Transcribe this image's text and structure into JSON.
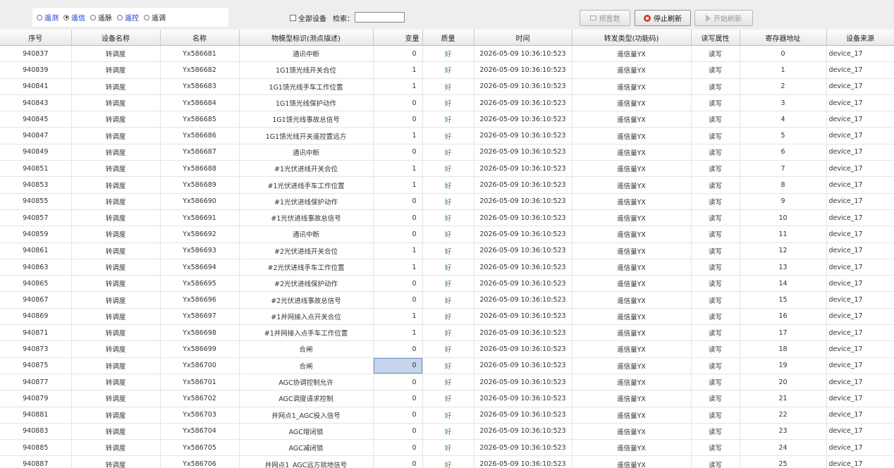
{
  "toolbar": {
    "radios": [
      {
        "label": "遥测",
        "selected": false,
        "color": "#1a36c4"
      },
      {
        "label": "遥信",
        "selected": true,
        "color": "#1a36c4"
      },
      {
        "label": "遥脉",
        "selected": false,
        "color": "#222222"
      },
      {
        "label": "遥控",
        "selected": false,
        "color": "#1a36c4"
      },
      {
        "label": "遥调",
        "selected": false,
        "color": "#222222"
      }
    ],
    "all_devices_label": "全部设备",
    "all_devices_checked": false,
    "search_label": "检索：",
    "search_value": "",
    "preset_button": "预置数",
    "stop_refresh_button": "停止刷新",
    "start_refresh_button": "开始刷新"
  },
  "table": {
    "columns": [
      "序号",
      "设备名称",
      "名称",
      "物模型标识(测点描述)",
      "变量",
      "质量",
      "时间",
      "转发类型(功能码)",
      "读写属性",
      "寄存器地址",
      "设备来源"
    ],
    "selected_row": 19,
    "selected_col": 4,
    "rows": [
      [
        "940837",
        "转调度",
        "Yx586681",
        "通讯中断",
        "0",
        "好",
        "2026-05-09 10:36:10:523",
        "遥信量YX",
        "读写",
        "0",
        "device_17"
      ],
      [
        "940839",
        "转调度",
        "Yx586682",
        "1G1馈光线开关合位",
        "1",
        "好",
        "2026-05-09 10:36:10:523",
        "遥信量YX",
        "读写",
        "1",
        "device_17"
      ],
      [
        "940841",
        "转调度",
        "Yx586683",
        "1G1馈光线手车工作位置",
        "1",
        "好",
        "2026-05-09 10:36:10:523",
        "遥信量YX",
        "读写",
        "2",
        "device_17"
      ],
      [
        "940843",
        "转调度",
        "Yx586684",
        "1G1馈光线保护动作",
        "0",
        "好",
        "2026-05-09 10:36:10:523",
        "遥信量YX",
        "读写",
        "3",
        "device_17"
      ],
      [
        "940845",
        "转调度",
        "Yx586685",
        "1G1馈光线事故总信号",
        "0",
        "好",
        "2026-05-09 10:36:10:523",
        "遥信量YX",
        "读写",
        "4",
        "device_17"
      ],
      [
        "940847",
        "转调度",
        "Yx586686",
        "1G1馈光线开关遥控置远方",
        "1",
        "好",
        "2026-05-09 10:36:10:523",
        "遥信量YX",
        "读写",
        "5",
        "device_17"
      ],
      [
        "940849",
        "转调度",
        "Yx586687",
        "通讯中断",
        "0",
        "好",
        "2026-05-09 10:36:10:523",
        "遥信量YX",
        "读写",
        "6",
        "device_17"
      ],
      [
        "940851",
        "转调度",
        "Yx586688",
        "#1光伏进线开关合位",
        "1",
        "好",
        "2026-05-09 10:36:10:523",
        "遥信量YX",
        "读写",
        "7",
        "device_17"
      ],
      [
        "940853",
        "转调度",
        "Yx586689",
        "#1光伏进线手车工作位置",
        "1",
        "好",
        "2026-05-09 10:36:10:523",
        "遥信量YX",
        "读写",
        "8",
        "device_17"
      ],
      [
        "940855",
        "转调度",
        "Yx586690",
        "#1光伏进线保护动作",
        "0",
        "好",
        "2026-05-09 10:36:10:523",
        "遥信量YX",
        "读写",
        "9",
        "device_17"
      ],
      [
        "940857",
        "转调度",
        "Yx586691",
        "#1光伏进线事故总信号",
        "0",
        "好",
        "2026-05-09 10:36:10:523",
        "遥信量YX",
        "读写",
        "10",
        "device_17"
      ],
      [
        "940859",
        "转调度",
        "Yx586692",
        "通讯中断",
        "0",
        "好",
        "2026-05-09 10:36:10:523",
        "遥信量YX",
        "读写",
        "11",
        "device_17"
      ],
      [
        "940861",
        "转调度",
        "Yx586693",
        "#2光伏进线开关合位",
        "1",
        "好",
        "2026-05-09 10:36:10:523",
        "遥信量YX",
        "读写",
        "12",
        "device_17"
      ],
      [
        "940863",
        "转调度",
        "Yx586694",
        "#2光伏进线手车工作位置",
        "1",
        "好",
        "2026-05-09 10:36:10:523",
        "遥信量YX",
        "读写",
        "13",
        "device_17"
      ],
      [
        "940865",
        "转调度",
        "Yx586695",
        "#2光伏进线保护动作",
        "0",
        "好",
        "2026-05-09 10:36:10:523",
        "遥信量YX",
        "读写",
        "14",
        "device_17"
      ],
      [
        "940867",
        "转调度",
        "Yx586696",
        "#2光伏进线事故总信号",
        "0",
        "好",
        "2026-05-09 10:36:10:523",
        "遥信量YX",
        "读写",
        "15",
        "device_17"
      ],
      [
        "940869",
        "转调度",
        "Yx586697",
        "#1并网接入点开关合位",
        "1",
        "好",
        "2026-05-09 10:36:10:523",
        "遥信量YX",
        "读写",
        "16",
        "device_17"
      ],
      [
        "940871",
        "转调度",
        "Yx586698",
        "#1并网接入点手车工作位置",
        "1",
        "好",
        "2026-05-09 10:36:10:523",
        "遥信量YX",
        "读写",
        "17",
        "device_17"
      ],
      [
        "940873",
        "转调度",
        "Yx586699",
        "合闸",
        "0",
        "好",
        "2026-05-09 10:36:10:523",
        "遥信量YX",
        "读写",
        "18",
        "device_17"
      ],
      [
        "940875",
        "转调度",
        "Yx586700",
        "合闸",
        "0",
        "好",
        "2026-05-09 10:36:10:523",
        "遥信量YX",
        "读写",
        "19",
        "device_17"
      ],
      [
        "940877",
        "转调度",
        "Yx586701",
        "AGC协调控制允许",
        "0",
        "好",
        "2026-05-09 10:36:10:523",
        "遥信量YX",
        "读写",
        "20",
        "device_17"
      ],
      [
        "940879",
        "转调度",
        "Yx586702",
        "AGC调度请求控制",
        "0",
        "好",
        "2026-05-09 10:36:10:523",
        "遥信量YX",
        "读写",
        "21",
        "device_17"
      ],
      [
        "940881",
        "转调度",
        "Yx586703",
        "并网点1_AGC投入信号",
        "0",
        "好",
        "2026-05-09 10:36:10:523",
        "遥信量YX",
        "读写",
        "22",
        "device_17"
      ],
      [
        "940883",
        "转调度",
        "Yx586704",
        "AGC增闭锁",
        "0",
        "好",
        "2026-05-09 10:36:10:523",
        "遥信量YX",
        "读写",
        "23",
        "device_17"
      ],
      [
        "940885",
        "转调度",
        "Yx586705",
        "AGC减闭锁",
        "0",
        "好",
        "2026-05-09 10:36:10:523",
        "遥信量YX",
        "读写",
        "24",
        "device_17"
      ],
      [
        "940887",
        "转调度",
        "Yx586706",
        "并网点1_AGC远方就地信号",
        "0",
        "好",
        "2026-05-09 10:36:10:523",
        "遥信量YX",
        "读写",
        "25",
        "device_17"
      ]
    ]
  }
}
